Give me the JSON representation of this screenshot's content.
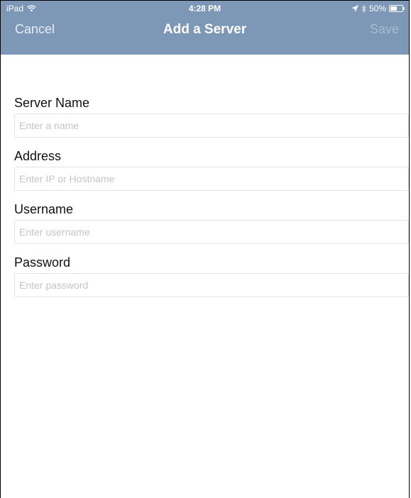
{
  "status_bar": {
    "device": "iPad",
    "time": "4:28 PM",
    "battery": "50%"
  },
  "nav": {
    "cancel_label": "Cancel",
    "title": "Add a Server",
    "save_label": "Save"
  },
  "fields": [
    {
      "label": "Server Name",
      "placeholder": "Enter a name",
      "value": ""
    },
    {
      "label": "Address",
      "placeholder": "Enter IP or Hostname",
      "value": ""
    },
    {
      "label": "Username",
      "placeholder": "Enter username",
      "value": ""
    },
    {
      "label": "Password",
      "placeholder": "Enter password",
      "value": ""
    }
  ],
  "icons": {
    "wifi": "wifi-icon",
    "location": "location-arrow-icon",
    "bluetooth": "bluetooth-icon",
    "battery": "battery-icon"
  },
  "colors": {
    "bar_background": "#7d97b6",
    "title": "#ffffff",
    "cancel": "#e8eef6",
    "save_disabled": "#a9bbd0"
  }
}
